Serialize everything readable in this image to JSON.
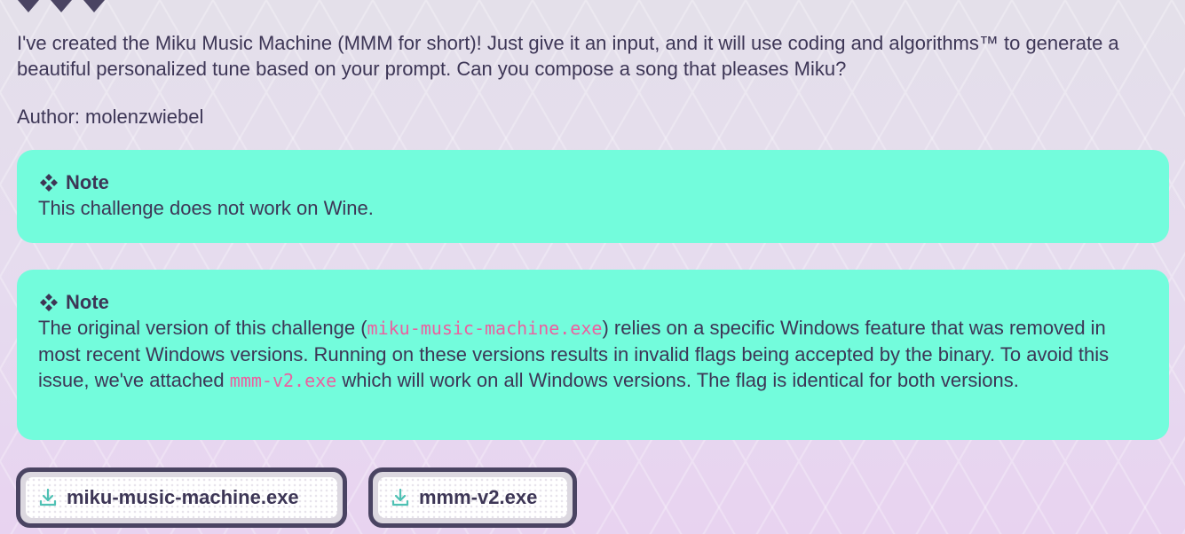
{
  "hearts": {
    "count": 3,
    "color": "#4a4462",
    "icon": "heart-icon"
  },
  "description": {
    "text": "I've created the Miku Music Machine (MMM for short)! Just give it an input, and it will use coding and algorithms™ to generate a beautiful personalized tune based on your prompt. Can you compose a song that pleases Miku?"
  },
  "author": {
    "text": "Author: molenzwiebel"
  },
  "notes": [
    {
      "icon": "diamond-icon",
      "title": "Note",
      "text": "This challenge does not work on Wine."
    },
    {
      "icon": "diamond-icon",
      "title": "Note",
      "part1": "The original version of this challenge (",
      "code1": "miku-music-machine.exe",
      "part2": ") relies on a specific Windows feature that was removed in most recent Windows versions. Running on these versions results in invalid flags being accepted by the binary. To avoid this issue, we've attached ",
      "code2": "mmm-v2.exe",
      "part3": " which will work on all Windows versions. The flag is identical for both versions."
    }
  ],
  "downloads": [
    {
      "label": "miku-music-machine.exe",
      "icon": "download-icon"
    },
    {
      "label": "mmm-v2.exe",
      "icon": "download-icon"
    }
  ],
  "colors": {
    "note_bg": "#73fcdc",
    "code_text": "#ec5f9f",
    "text": "#3d3656",
    "button_border": "#4a4462",
    "download_icon": "#4fc1b4"
  }
}
